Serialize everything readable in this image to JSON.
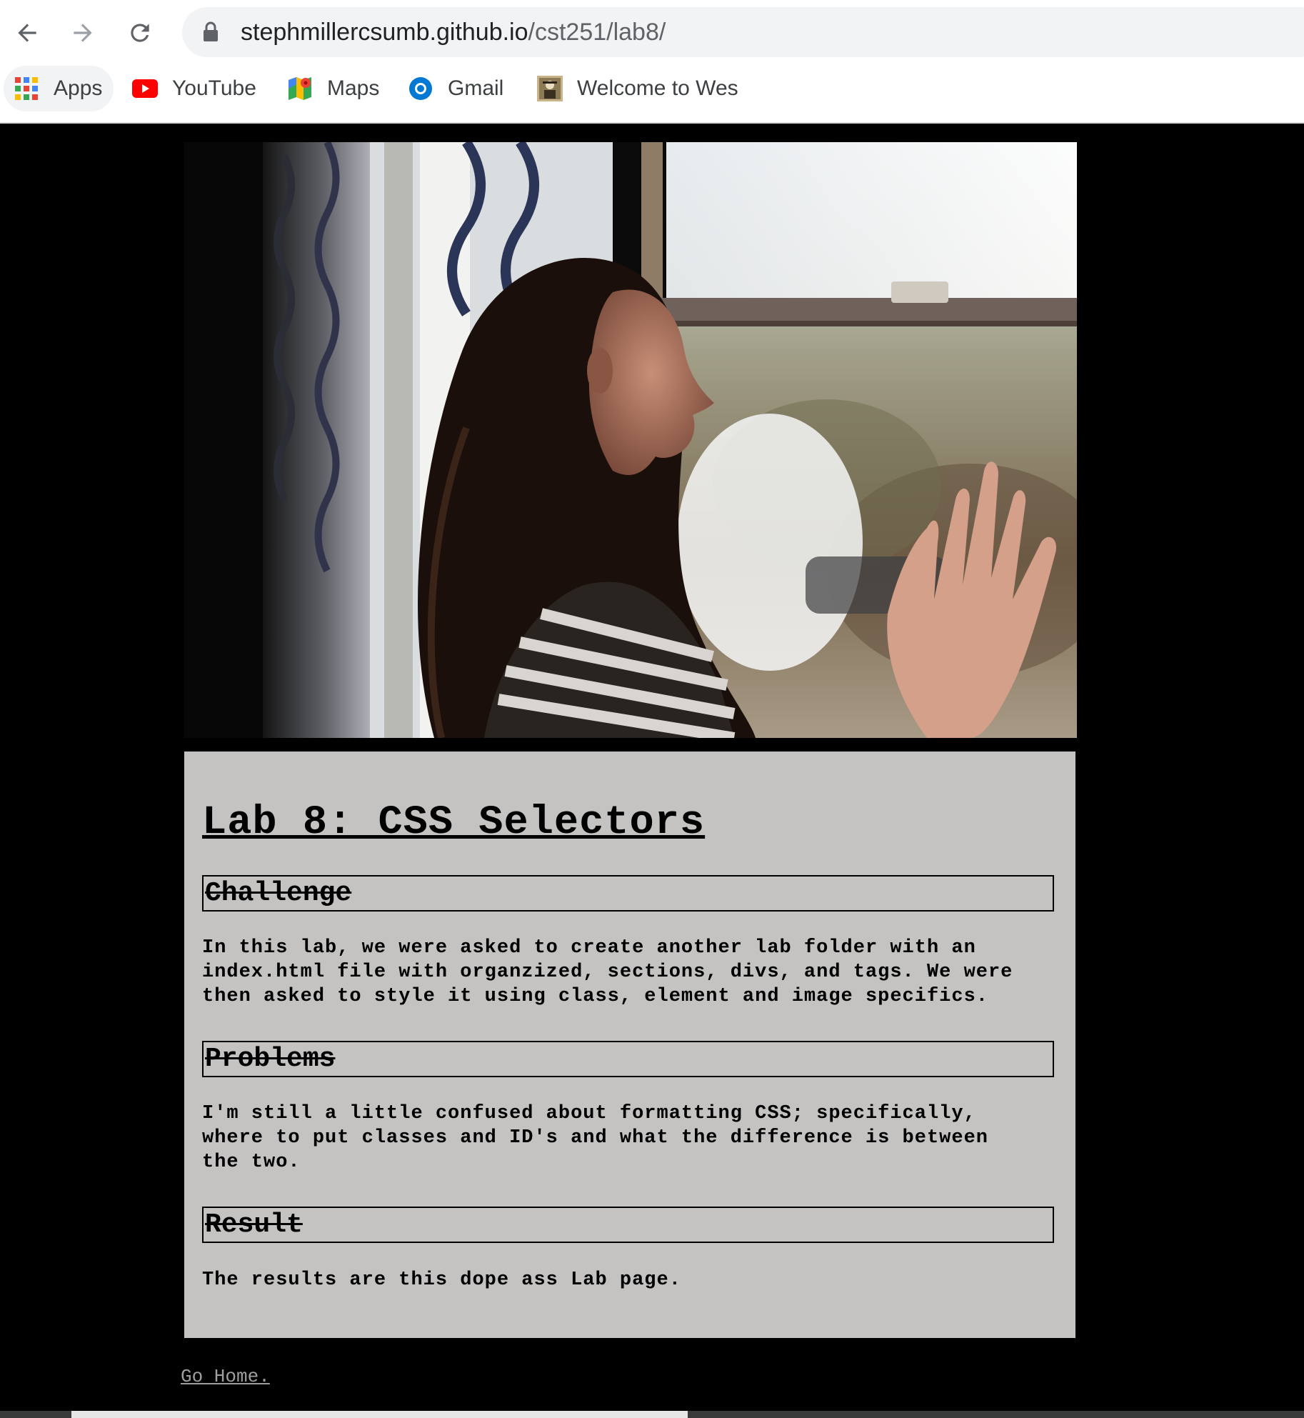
{
  "browser": {
    "url_host": "stephmillercsumb.github.io",
    "url_path": "/cst251/lab8/",
    "bookmarks": [
      {
        "label": "Apps",
        "icon": "apps-grid-icon"
      },
      {
        "label": "YouTube",
        "icon": "youtube-icon"
      },
      {
        "label": "Maps",
        "icon": "maps-icon"
      },
      {
        "label": "Gmail",
        "icon": "gmail-icon"
      },
      {
        "label": "Welcome to Wes",
        "icon": "site-favicon"
      }
    ]
  },
  "page": {
    "title": "Lab 8: CSS Selectors",
    "sections": [
      {
        "heading": "Challenge",
        "text": "In this lab, we were asked to create another lab folder with an\nindex.html file with organzized, sections, divs, and tags. We were\nthen asked to style it using class, element and image specifics."
      },
      {
        "heading": "Problems",
        "text": "I'm still a little confused about formatting CSS; specifically,\nwhere to put classes and ID's and what the difference is between\nthe two."
      },
      {
        "heading": "Result",
        "text": "The results are this dope ass Lab page."
      }
    ],
    "footer_link": "Go Home."
  },
  "colors": {
    "page_background": "#000000",
    "content_background": "#c4c3c2",
    "link": "#9e9e9e"
  }
}
